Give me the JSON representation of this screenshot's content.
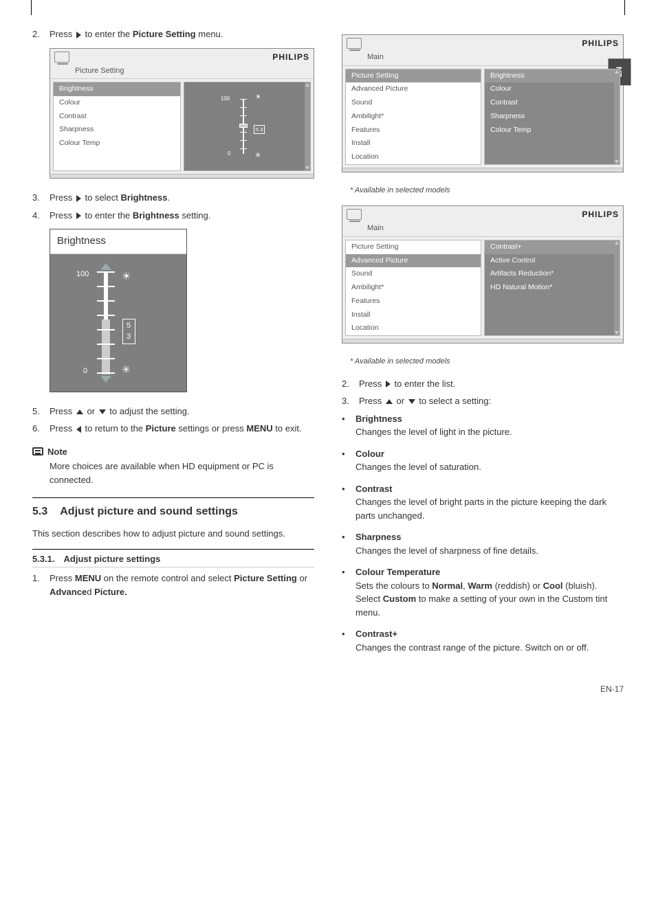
{
  "lang_tab": "EN",
  "philips": "PHILIPS",
  "steps": {
    "s2_a": "Press",
    "s2_b": "to enter the",
    "s2_bold": "Picture Setting",
    "s2_c": "menu.",
    "s3_a": "Press",
    "s3_b": "to select",
    "s3_bold": "Brightness",
    "s3_c": ".",
    "s4_a": "Press",
    "s4_b": "to enter the",
    "s4_bold": "Brightness",
    "s4_c": "setting.",
    "s5_a": "Press",
    "s5_b": "or",
    "s5_c": "to adjust the setting.",
    "s6_a": "Press",
    "s6_b": "to return to the",
    "s6_bold": "Picture",
    "s6_c": "settings or press",
    "s6_bold2": "MENU",
    "s6_d": "to exit.",
    "r2_a": "Press",
    "r2_b": "to enter the list.",
    "r3_a": "Press",
    "r3_b": "or",
    "r3_c": "to select a setting:"
  },
  "menu1": {
    "title": "Picture Setting",
    "items": [
      "Brightness",
      "Colour",
      "Contrast",
      "Sharpness",
      "Colour Temp"
    ],
    "slider": {
      "max": "100",
      "min": "0",
      "value": "5 3"
    }
  },
  "brightness_large": {
    "title": "Brightness",
    "max": "100",
    "min": "0",
    "value": "5 3"
  },
  "note": {
    "title": "Note",
    "body": "More choices are available when HD equipment or PC is connected."
  },
  "h53": {
    "num": "5.3",
    "title": "Adjust picture and sound settings"
  },
  "h53_intro": "This section describes how to adjust picture and sound settings.",
  "h531": "5.3.1. Adjust picture settings",
  "step1": {
    "a": "Press",
    "b1": "MENU",
    "c": "on the remote control and select",
    "b2": "Picture Setting",
    "d": "or",
    "b3": "Advance",
    "e": "d",
    "b4": "Picture."
  },
  "menu2": {
    "title": "Main",
    "left": [
      "Picture Setting",
      "Advanced Picture",
      "Sound",
      "Ambilight*",
      "Features",
      "Install",
      "Location"
    ],
    "right": [
      "Brightness",
      "Colour",
      "Contrast",
      "Sharpness",
      "Colour Temp"
    ]
  },
  "menu3": {
    "title": "Main",
    "left": [
      "Picture Setting",
      "Advanced Picture",
      "Sound",
      "Ambilight*",
      "Features",
      "Install",
      "Location"
    ],
    "right": [
      "Contrast+",
      "Active Control",
      "Artifacts Reduction*",
      "HD Natural Motion*"
    ]
  },
  "caption": "* Available in selected models",
  "defs": [
    {
      "t": "Brightness",
      "d": "Changes the level of light in the picture."
    },
    {
      "t": "Colour",
      "d": "Changes the level of saturation."
    },
    {
      "t": "Contrast",
      "d": "Changes the level of bright parts in the picture keeping the dark parts unchanged."
    },
    {
      "t": "Sharpness",
      "d": "Changes the level of sharpness of fine details."
    },
    {
      "t": "Colour Temperature",
      "d_parts": [
        "Sets the colours to ",
        "Normal",
        ", ",
        "Warm",
        " (reddish) or ",
        "Cool",
        " (bluish). Select ",
        "Custom",
        " to make a setting of your own in the Custom tint menu."
      ]
    },
    {
      "t": "Contrast+",
      "d": "Changes the contrast range of the picture. Switch on or off."
    }
  ],
  "page_num": "EN-17"
}
